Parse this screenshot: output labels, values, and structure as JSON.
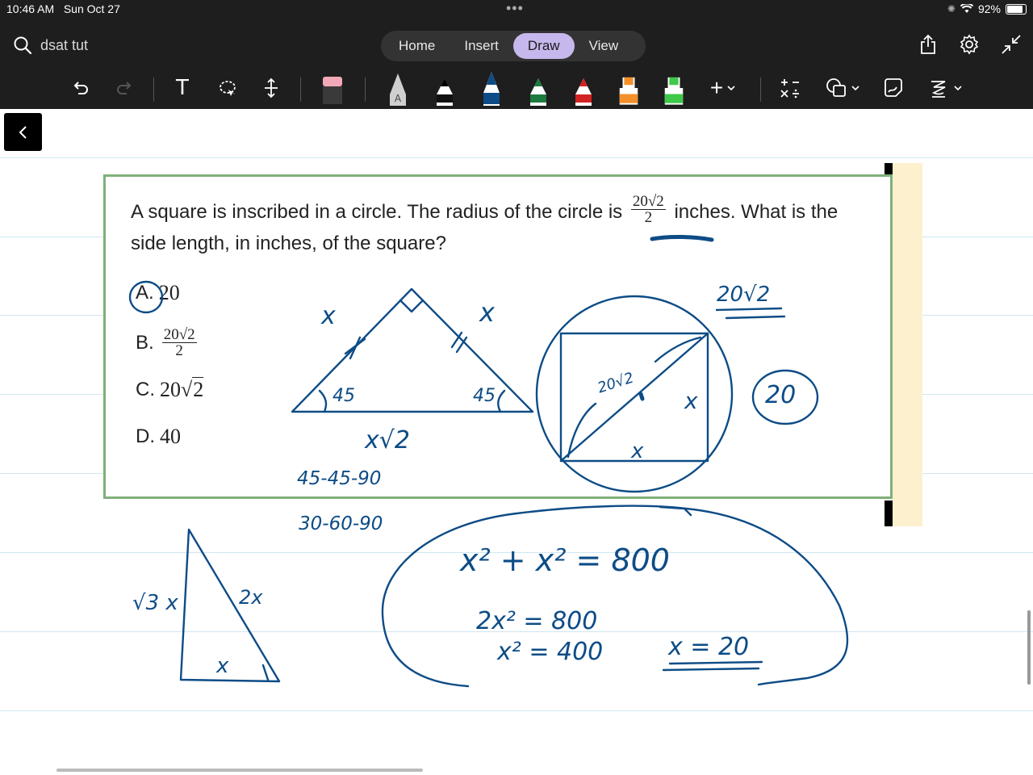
{
  "status_bar": {
    "time": "10:46 AM",
    "date": "Sun Oct 27",
    "battery": "92%"
  },
  "search": {
    "query": "dsat tut"
  },
  "tabs": [
    {
      "label": "Home"
    },
    {
      "label": "Insert"
    },
    {
      "label": "Draw",
      "active": true
    },
    {
      "label": "View"
    }
  ],
  "toolbar": {
    "text_tool_glyph": "T",
    "pen_a_label": "A",
    "plus_glyph": "+"
  },
  "colors": {
    "ink": "#0d4c86",
    "card_border": "#7fb07a",
    "active_tab": "#c6b8ec",
    "note_strip": "#fdf0cf"
  },
  "question": {
    "text_before": "A square is inscribed in a circle. The radius of the circle is",
    "radius_num": "20√2",
    "radius_den": "2",
    "text_after": "inches. What is the side length, in inches, of the square?",
    "options": [
      {
        "letter": "A.",
        "value": "20"
      },
      {
        "letter": "B.",
        "num": "20√2",
        "den": "2"
      },
      {
        "letter": "C.",
        "coef": "20",
        "radical": "2"
      },
      {
        "letter": "D.",
        "value": "40"
      }
    ]
  },
  "handwriting": {
    "tri_leg_left": "x",
    "tri_leg_right": "x",
    "tri_angle_left": "45",
    "tri_angle_right": "45",
    "tri_hyp": "x√2",
    "ratio_1": "45-45-90",
    "ratio_2": "30-60-90",
    "diag_label": "20√2",
    "side_right": "x",
    "side_bottom": "x",
    "top_note": "20√2",
    "circled_answer": "20",
    "small_tri_left": "√3 x",
    "small_tri_right": "2x",
    "small_tri_bottom": "x",
    "eq1": "x² + x² = 800",
    "eq2": "2x² = 800",
    "eq3": "x² = 400",
    "eq4": "x = 20"
  }
}
